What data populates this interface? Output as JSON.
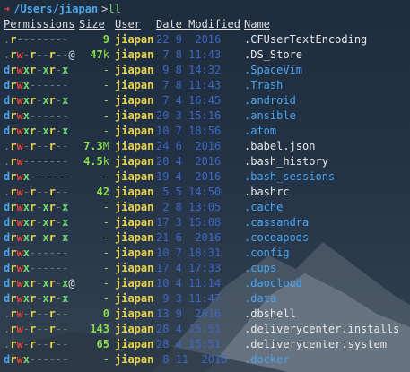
{
  "prompt": {
    "arrow": "➜",
    "cwd": "/Users/jiapan",
    "separator": ">",
    "command": "ll"
  },
  "headers": {
    "permissions": "Permissions",
    "size": "Size",
    "user": "User",
    "date": "Date Modified",
    "name": "Name"
  },
  "rows": [
    {
      "perm": ".r--------",
      "size": "9",
      "user": "jiapan",
      "date": "22 9  2016",
      "name": ".CFUserTextEncoding",
      "dir": false
    },
    {
      "perm": ".rw-r--r--@",
      "size": "47k",
      "user": "jiapan",
      "date": " 7 8 11:43",
      "name": ".DS_Store",
      "dir": false
    },
    {
      "perm": "drwxr-xr-x",
      "size": "-",
      "user": "jiapan",
      "date": " 9 8 14:32",
      "name": ".SpaceVim",
      "dir": true
    },
    {
      "perm": "drwx------",
      "size": "-",
      "user": "jiapan",
      "date": " 7 8 11:43",
      "name": ".Trash",
      "dir": true
    },
    {
      "perm": "drwxr-xr-x",
      "size": "-",
      "user": "jiapan",
      "date": " 7 4 16:45",
      "name": ".android",
      "dir": true
    },
    {
      "perm": "drwx------",
      "size": "-",
      "user": "jiapan",
      "date": "20 3 15:16",
      "name": ".ansible",
      "dir": true
    },
    {
      "perm": "drwxr-xr-x",
      "size": "-",
      "user": "jiapan",
      "date": "10 7 18:56",
      "name": ".atom",
      "dir": true
    },
    {
      "perm": ".rw-r--r--",
      "size": "7.3M",
      "user": "jiapan",
      "date": "24 6  2016",
      "name": ".babel.json",
      "dir": false
    },
    {
      "perm": ".rw-------",
      "size": "4.5k",
      "user": "jiapan",
      "date": "20 4  2016",
      "name": ".bash_history",
      "dir": false
    },
    {
      "perm": "drwx------",
      "size": "-",
      "user": "jiapan",
      "date": "19 4  2016",
      "name": ".bash_sessions",
      "dir": true
    },
    {
      "perm": ".rw-r--r--",
      "size": "42",
      "user": "jiapan",
      "date": " 5 5 14:50",
      "name": ".bashrc",
      "dir": false
    },
    {
      "perm": "drwxr-xr-x",
      "size": "-",
      "user": "jiapan",
      "date": " 2 8 13:05",
      "name": ".cache",
      "dir": true
    },
    {
      "perm": "drwxr-xr-x",
      "size": "-",
      "user": "jiapan",
      "date": "17 3 15:08",
      "name": ".cassandra",
      "dir": true
    },
    {
      "perm": "drwxr-xr-x",
      "size": "-",
      "user": "jiapan",
      "date": "21 6  2016",
      "name": ".cocoapods",
      "dir": true
    },
    {
      "perm": "drwx------",
      "size": "-",
      "user": "jiapan",
      "date": "10 7 18:31",
      "name": ".config",
      "dir": true
    },
    {
      "perm": "drwx------",
      "size": "-",
      "user": "jiapan",
      "date": "17 4 17:33",
      "name": ".cups",
      "dir": true
    },
    {
      "perm": "drwxr-xr-x@",
      "size": "-",
      "user": "jiapan",
      "date": "10 4 11:14",
      "name": ".daocloud",
      "dir": true
    },
    {
      "perm": "drwxr-xr-x",
      "size": "-",
      "user": "jiapan",
      "date": " 9 3 11:47",
      "name": ".data",
      "dir": true
    },
    {
      "perm": ".rw-r--r--",
      "size": "0",
      "user": "jiapan",
      "date": "13 9  2016",
      "name": ".dbshell",
      "dir": false
    },
    {
      "perm": ".rw-r--r--",
      "size": "143",
      "user": "jiapan",
      "date": "28 4 15:51",
      "name": ".deliverycenter.installs",
      "dir": false
    },
    {
      "perm": ".rw-r--r--",
      "size": "65",
      "user": "jiapan",
      "date": "28 4 15:51",
      "name": ".deliverycenter.system",
      "dir": false
    },
    {
      "perm": "drwx------",
      "size": "-",
      "user": "jiapan",
      "date": " 8 11  2016",
      "name": ".docker",
      "dir": true
    }
  ],
  "colors": {
    "directory": "#4aa5f0",
    "read": "#e8d34a",
    "write": "#e0463c",
    "execute": "#6fd96f",
    "size": "#8be04a",
    "user": "#e8d34a",
    "date": "#3d66c4"
  }
}
